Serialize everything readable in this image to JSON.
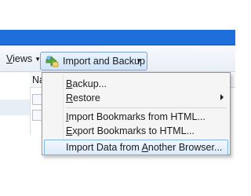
{
  "toolbar": {
    "views": {
      "prefix": "",
      "mnemonic": "V",
      "rest": "iews"
    },
    "import_backup": {
      "label": "Import and Backup"
    }
  },
  "column_header": {
    "label": "Na"
  },
  "menu": {
    "items": [
      {
        "mn": "B",
        "rest": "ackup...",
        "has_submenu": false,
        "highlighted": false
      },
      {
        "mn": "R",
        "rest": "estore",
        "has_submenu": true,
        "highlighted": false
      },
      {
        "mn": "I",
        "rest": "mport Bookmarks from HTML...",
        "has_submenu": false,
        "highlighted": false
      },
      {
        "mn": "E",
        "rest": "xport Bookmarks to HTML...",
        "has_submenu": false,
        "highlighted": false
      },
      {
        "pre": "Import Data from ",
        "mn": "A",
        "rest": "nother Browser...",
        "has_submenu": false,
        "highlighted": true
      }
    ]
  },
  "colors": {
    "title_band": "#1e6fd9",
    "highlight_border": "#7eb4ea",
    "menu_bg": "#f5f5f5"
  }
}
